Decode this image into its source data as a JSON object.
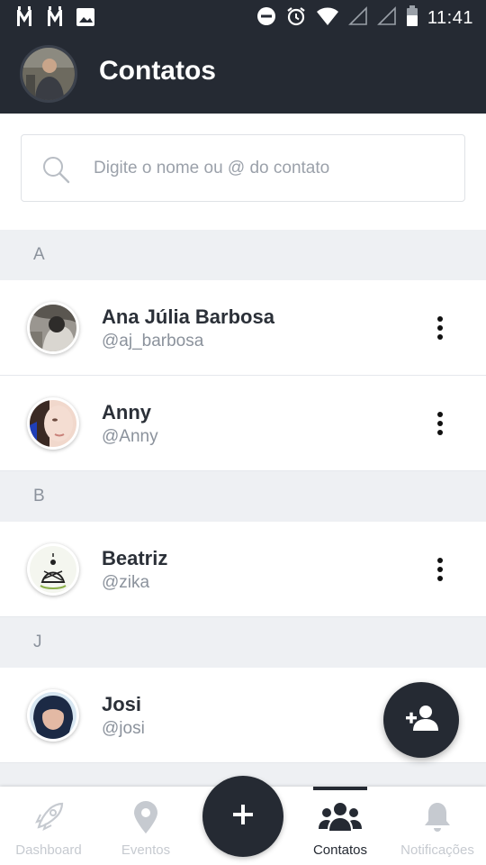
{
  "status_bar": {
    "time": "11:41",
    "left_icons": [
      "gmail-icon",
      "gmail-icon",
      "image-icon"
    ],
    "right_icons": [
      "do-not-disturb-icon",
      "alarm-icon",
      "wifi-icon",
      "signal-icon",
      "signal-icon",
      "battery-icon"
    ]
  },
  "header": {
    "title": "Contatos"
  },
  "search": {
    "placeholder": "Digite o nome ou @ do contato",
    "value": ""
  },
  "sections": [
    {
      "letter": "A",
      "contacts": [
        {
          "name": "Ana Júlia Barbosa",
          "handle": "@aj_barbosa"
        },
        {
          "name": "Anny",
          "handle": "@Anny"
        }
      ]
    },
    {
      "letter": "B",
      "contacts": [
        {
          "name": "Beatriz",
          "handle": "@zika"
        }
      ]
    },
    {
      "letter": "J",
      "contacts": [
        {
          "name": "Josi",
          "handle": "@josi"
        }
      ]
    }
  ],
  "bottom_nav": {
    "items": [
      {
        "label": "Dashboard",
        "icon": "rocket-icon",
        "active": false
      },
      {
        "label": "Eventos",
        "icon": "map-pin-icon",
        "active": false
      },
      {
        "label": "Contatos",
        "icon": "people-icon",
        "active": true
      },
      {
        "label": "Notificações",
        "icon": "bell-icon",
        "active": false
      }
    ],
    "center_button": "+"
  },
  "colors": {
    "primary_dark": "#252a33",
    "section_bg": "#eef0f3",
    "muted_text": "#8b929c",
    "inactive_nav": "#c6cad0"
  }
}
